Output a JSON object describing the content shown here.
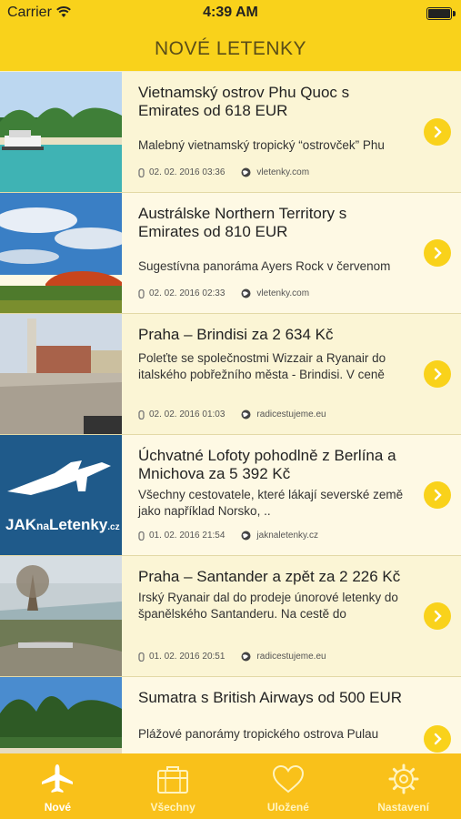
{
  "status_bar": {
    "carrier": "Carrier",
    "time": "4:39 AM"
  },
  "nav": {
    "title": "NOVÉ LETENKY"
  },
  "articles": [
    {
      "title": "Vietnamský ostrov Phu Quoc s Emirates od 618 EUR",
      "description": "Malebný vietnamský tropický “ostrovček” Phu",
      "date": "02. 02. 2016 03:36",
      "source": "vletenky.com",
      "image": "beach-boat"
    },
    {
      "title": "Austrálske Northern Territory s Emirates od 810 EUR",
      "description": "Sugestívna panoráma Ayers Rock v červenom",
      "date": "02. 02. 2016 02:33",
      "source": "vletenky.com",
      "image": "ayers-rock"
    },
    {
      "title": "Praha – Brindisi za 2 634 Kč",
      "description": "Poleťte se společnostmi  Wizzair a Ryanair do italského pobřežního města - Brindisi. V ceně",
      "date": "02. 02. 2016 01:03",
      "source": "radicestujeme.eu",
      "image": "brindisi-steps"
    },
    {
      "title": "Úchvatné Lofoty pohodlně z Berlína a Mnichova za 5 392 Kč",
      "description": "Všechny cestovatele, které lákají severské země jako například Norsko, ..",
      "date": "01. 02. 2016 21:54",
      "source": "jaknaletenky.cz",
      "image": "jaknaletenky-logo",
      "logo_text": {
        "a": "JAK",
        "b": "na",
        "c": "Letenky",
        "d": ".cz"
      }
    },
    {
      "title": "Praha – Santander a zpět za 2 226 Kč",
      "description": "Irský Ryanair dal do prodeje únorové letenky do španělského Santanderu. Na cestě do",
      "date": "01. 02. 2016 20:51",
      "source": "radicestujeme.eu",
      "image": "santander-bay"
    },
    {
      "title": "Sumatra s British Airways od 500 EUR",
      "description": "Plážové panorámy tropického ostrova Pulau",
      "date": "",
      "source": "",
      "image": "sumatra-beach"
    }
  ],
  "tabs": [
    {
      "label": "Nové",
      "icon": "airplane-icon",
      "active": true
    },
    {
      "label": "Všechny",
      "icon": "briefcase-icon",
      "active": false
    },
    {
      "label": "Uložené",
      "icon": "heart-icon",
      "active": false
    },
    {
      "label": "Nastavení",
      "icon": "gear-icon",
      "active": false
    }
  ],
  "colors": {
    "accent": "#f9d21b",
    "tabbar": "#f9c11a",
    "row_bg": "#fbf5d5",
    "nav_title": "#5b4e18"
  }
}
